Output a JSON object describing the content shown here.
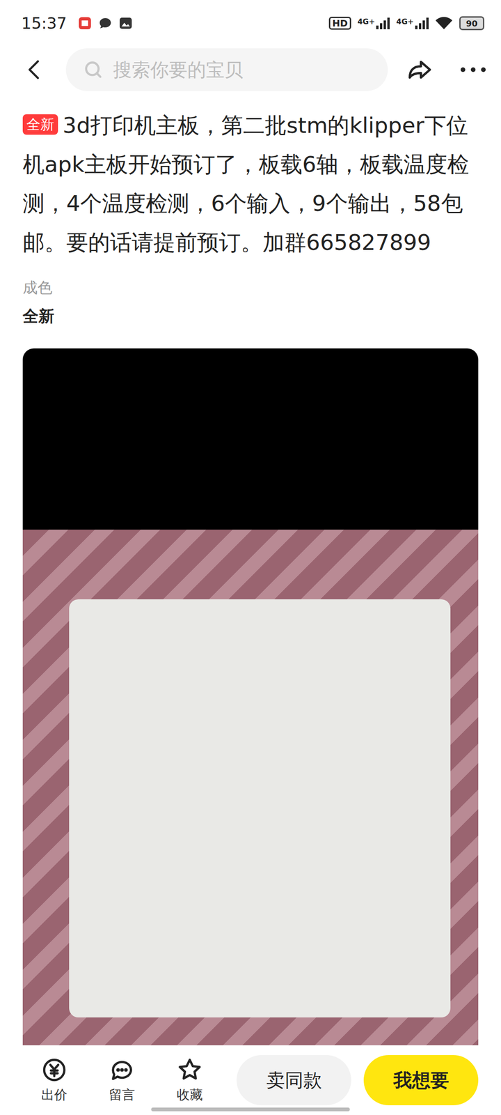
{
  "status_bar": {
    "time": "15:37",
    "hd": "HD",
    "networks": [
      "4G+",
      "4G+"
    ],
    "battery": "90"
  },
  "header": {
    "search_placeholder": "搜索你要的宝贝"
  },
  "listing": {
    "badge": "全新",
    "title": "3d打印机主板，第二批stm的klipper下位机apk主板开始预订了，板载6轴，板载温度检测，4个温度检测，6个输入，9个输出，58包邮。要的话请提前预订。加群665827899",
    "attributes": [
      {
        "label": "成色",
        "value": "全新"
      }
    ]
  },
  "bottom_bar": {
    "actions": [
      {
        "label": "出价",
        "icon": "price"
      },
      {
        "label": "留言",
        "icon": "comment"
      },
      {
        "label": "收藏",
        "icon": "star"
      }
    ],
    "buttons": [
      {
        "label": "卖同款",
        "primary": false
      },
      {
        "label": "我想要",
        "primary": true
      }
    ]
  }
}
